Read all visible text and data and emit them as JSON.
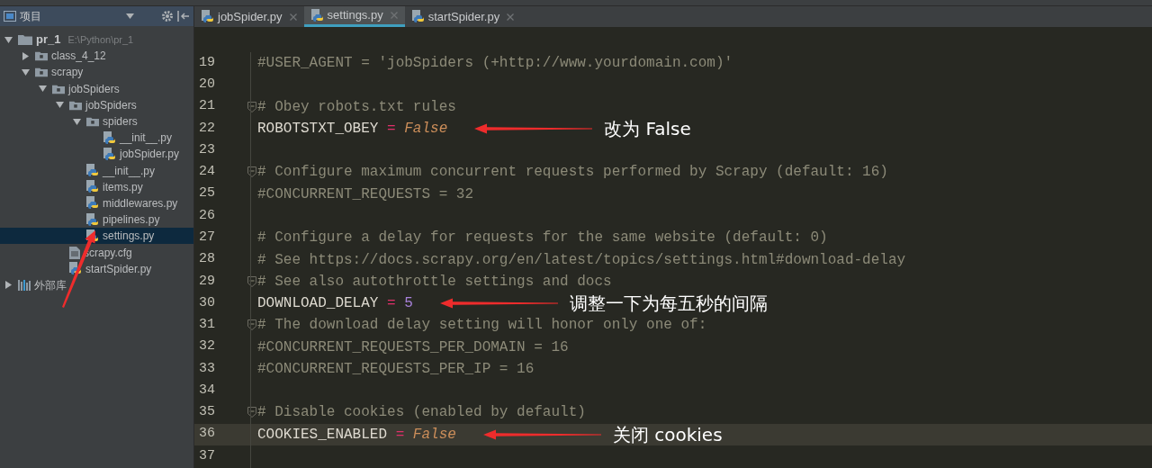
{
  "sidebar": {
    "title": "项目",
    "tree": [
      {
        "name": "pr_1",
        "kind": "project",
        "path": "E:\\Python\\pr_1",
        "expanded": true,
        "selected": false,
        "children": [
          {
            "name": "class_4_12",
            "kind": "folder",
            "expanded": false,
            "selected": false
          },
          {
            "name": "scrapy",
            "kind": "folder",
            "expanded": true,
            "selected": false,
            "children": [
              {
                "name": "jobSpiders",
                "kind": "folder",
                "expanded": true,
                "selected": false,
                "children": [
                  {
                    "name": "jobSpiders",
                    "kind": "folder",
                    "expanded": true,
                    "selected": false,
                    "children": [
                      {
                        "name": "spiders",
                        "kind": "folder",
                        "expanded": true,
                        "selected": false,
                        "children": [
                          {
                            "name": "__init__.py",
                            "kind": "python",
                            "selected": false
                          },
                          {
                            "name": "jobSpider.py",
                            "kind": "python",
                            "selected": false
                          }
                        ]
                      },
                      {
                        "name": "__init__.py",
                        "kind": "python",
                        "selected": false
                      },
                      {
                        "name": "items.py",
                        "kind": "python",
                        "selected": false
                      },
                      {
                        "name": "middlewares.py",
                        "kind": "python",
                        "selected": false
                      },
                      {
                        "name": "pipelines.py",
                        "kind": "python",
                        "selected": false
                      },
                      {
                        "name": "settings.py",
                        "kind": "python",
                        "selected": true
                      }
                    ]
                  },
                  {
                    "name": "scrapy.cfg",
                    "kind": "config",
                    "selected": false
                  },
                  {
                    "name": "startSpider.py",
                    "kind": "python",
                    "selected": false
                  }
                ]
              }
            ]
          }
        ]
      },
      {
        "name": "外部库",
        "kind": "library",
        "expanded": false,
        "selected": false
      }
    ]
  },
  "tabs": [
    {
      "label": "jobSpider.py",
      "selected": false
    },
    {
      "label": "settings.py",
      "selected": true
    },
    {
      "label": "startSpider.py",
      "selected": false
    }
  ],
  "editor": {
    "lines": [
      {
        "number": "19",
        "current": false,
        "fold": false,
        "tokens": [
          {
            "text": "#USER_AGENT = 'jobSpiders (+http://www.yourdomain.com)'",
            "kind": "comment"
          }
        ]
      },
      {
        "number": "20",
        "current": false,
        "fold": false
      },
      {
        "number": "21",
        "current": false,
        "fold": true,
        "tokens": [
          {
            "text": "# Obey robots.txt rules",
            "kind": "comment"
          }
        ]
      },
      {
        "number": "22",
        "current": false,
        "fold": false,
        "tokens": [
          {
            "text": "ROBOTSTXT_OBEY",
            "kind": "plain"
          },
          {
            "text": " = ",
            "kind": "operator"
          },
          {
            "text": "False",
            "kind": "keyword"
          }
        ],
        "note": "改为 False"
      },
      {
        "number": "23",
        "current": false,
        "fold": false
      },
      {
        "number": "24",
        "current": false,
        "fold": true,
        "tokens": [
          {
            "text": "# Configure maximum concurrent requests performed by Scrapy (default: 16)",
            "kind": "comment"
          }
        ]
      },
      {
        "number": "25",
        "current": false,
        "fold": false,
        "tokens": [
          {
            "text": "#CONCURRENT_REQUESTS = 32",
            "kind": "comment"
          }
        ]
      },
      {
        "number": "26",
        "current": false,
        "fold": false
      },
      {
        "number": "27",
        "current": false,
        "fold": false,
        "tokens": [
          {
            "text": "# Configure a delay for requests for the same website (default: 0)",
            "kind": "comment"
          }
        ]
      },
      {
        "number": "28",
        "current": false,
        "fold": false,
        "tokens": [
          {
            "text": "# See https://docs.scrapy.org/en/latest/topics/settings.html#download-delay",
            "kind": "comment"
          }
        ]
      },
      {
        "number": "29",
        "current": false,
        "fold": true,
        "tokens": [
          {
            "text": "# See also autothrottle settings and docs",
            "kind": "comment"
          }
        ]
      },
      {
        "number": "30",
        "current": false,
        "fold": false,
        "tokens": [
          {
            "text": "DOWNLOAD_DELAY",
            "kind": "plain"
          },
          {
            "text": " = ",
            "kind": "operator"
          },
          {
            "text": "5",
            "kind": "number"
          }
        ],
        "note": "调整一下为每五秒的间隔"
      },
      {
        "number": "31",
        "current": false,
        "fold": true,
        "tokens": [
          {
            "text": "# The download delay setting will honor only one of:",
            "kind": "comment"
          }
        ]
      },
      {
        "number": "32",
        "current": false,
        "fold": false,
        "tokens": [
          {
            "text": "#CONCURRENT_REQUESTS_PER_DOMAIN = 16",
            "kind": "comment"
          }
        ]
      },
      {
        "number": "33",
        "current": false,
        "fold": false,
        "tokens": [
          {
            "text": "#CONCURRENT_REQUESTS_PER_IP = 16",
            "kind": "comment"
          }
        ]
      },
      {
        "number": "34",
        "current": false,
        "fold": false
      },
      {
        "number": "35",
        "current": false,
        "fold": true,
        "tokens": [
          {
            "text": "# Disable cookies (enabled by default)",
            "kind": "comment"
          }
        ]
      },
      {
        "number": "36",
        "current": true,
        "fold": false,
        "tokens": [
          {
            "text": "COOKIES_ENABLED",
            "kind": "plain"
          },
          {
            "text": " = ",
            "kind": "operator"
          },
          {
            "text": "False",
            "kind": "keyword"
          }
        ],
        "note": "关闭 cookies"
      },
      {
        "number": "37",
        "current": false,
        "fold": false
      }
    ]
  }
}
